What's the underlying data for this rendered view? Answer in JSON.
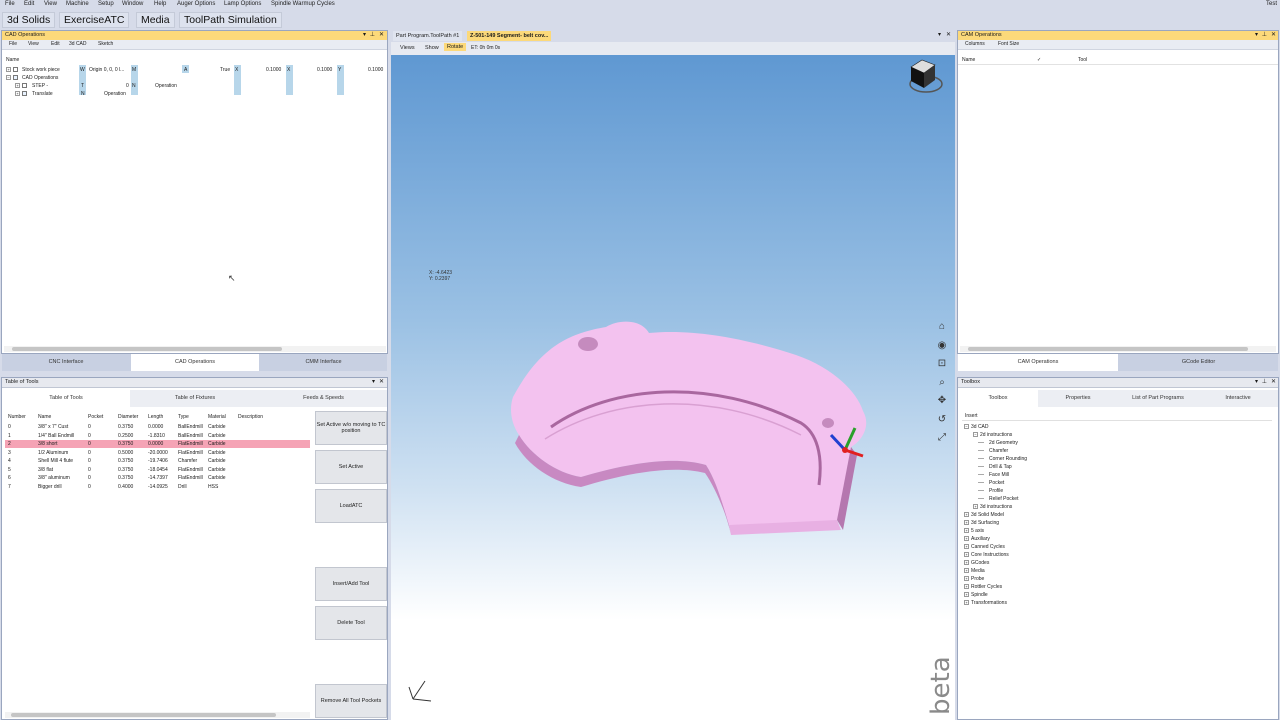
{
  "menu": [
    "File",
    "Edit",
    "View",
    "Machine",
    "Setup",
    "Window",
    "Help",
    "Auger Options",
    "Lamp Options",
    "Spindle Warmup Cycles"
  ],
  "menu_right": "Test",
  "toolbar": [
    "3d Solids",
    "ExerciseATC",
    "Media",
    "ToolPath Simulation"
  ],
  "cad_panel": {
    "title": "CAD Operations",
    "submenu": [
      "File",
      "View",
      "Edit",
      "3d CAD",
      "Sketch"
    ],
    "header_name": "Name",
    "rows": [
      {
        "label": "Stock work piece",
        "w": "W",
        "origin": "Origin 0, 0, 0 l...",
        "m": "M",
        "a": "A",
        "true_val": "True",
        "v1": "0.1000",
        "x": "X",
        "v2": "0.1000",
        "y": "Y",
        "v3": "0.1000"
      },
      {
        "label": "CAD Operations"
      },
      {
        "label": "STEP -",
        "t": "T",
        "zero": "0",
        "n": "N",
        "op": "Operation"
      },
      {
        "label": "Translate",
        "n": "N",
        "op": "Operation"
      }
    ],
    "tabs": [
      "CNC Interface",
      "CAD Operations",
      "CMM Interface"
    ]
  },
  "tools_panel": {
    "title": "Table of Tools",
    "tabs": [
      "Table of Tools",
      "Table of Fixtures",
      "Feeds & Speeds"
    ],
    "columns": [
      "Number",
      "Name",
      "Pocket",
      "Diameter",
      "Length",
      "Type",
      "Material",
      "Description"
    ],
    "rows": [
      [
        "0",
        "3/8\" x 7\" Cust",
        "0",
        "0.3750",
        "0.0000",
        "BallEndmill",
        "Carbide",
        ""
      ],
      [
        "1",
        "1/4\" Ball Endmill",
        "0",
        "0.2500",
        "-1.8310",
        "BallEndmill",
        "Carbide",
        ""
      ],
      [
        "2",
        "3/8 short",
        "0",
        "0.3750",
        "0.0000",
        "FlatEndmill",
        "Carbide",
        ""
      ],
      [
        "3",
        "1/2 Aluminum",
        "0",
        "0.5000",
        "-20.0000",
        "FlatEndmill",
        "Carbide",
        ""
      ],
      [
        "4",
        "Shell Mill 4 flute",
        "0",
        "0.3750",
        "-19.7406",
        "Chamfer",
        "Carbide",
        ""
      ],
      [
        "5",
        "3/8 flat",
        "0",
        "0.3750",
        "-18.0454",
        "FlatEndmill",
        "Carbide",
        ""
      ],
      [
        "6",
        "3/8\" aluminum",
        "0",
        "0.3750",
        "-14.7397",
        "FlatEndmill",
        "Carbide",
        ""
      ],
      [
        "7",
        "Bigger drill",
        "0",
        "0.4000",
        "-14.0925",
        "Drill",
        "HSS",
        ""
      ]
    ],
    "selected_row": 2,
    "buttons": [
      "Set Active w/o moving to TC position",
      "Set Active",
      "LoadATC",
      "Insert/Add Tool",
      "Delete Tool",
      "Remove All Tool Pockets"
    ]
  },
  "viewport": {
    "doc_tabs": [
      "Part Program.ToolPath #1",
      "Z-501-149 Segment- belt cov..."
    ],
    "view_menu": [
      "Views",
      "Show",
      "Rotate",
      "ET: 0h 0m 0s"
    ],
    "coord_x": "X: -4.6423",
    "coord_y": "Y: 0.2397",
    "watermark": "beta",
    "part_color": "#f5c6f2"
  },
  "cam_panel": {
    "title": "CAM Operations",
    "submenu": [
      "Columns",
      "Font Size"
    ],
    "columns": [
      "Name",
      "✓",
      "Tool"
    ],
    "tabs": [
      "CAM Operations",
      "GCode Editor"
    ]
  },
  "toolbox": {
    "title": "Toolbox",
    "tabs": [
      "Toolbox",
      "Properties",
      "List of Part Programs",
      "Interactive"
    ],
    "insert": "Insert",
    "tree": [
      {
        "label": "3d CAD",
        "level": 0,
        "exp": "-"
      },
      {
        "label": "2d instructions",
        "level": 1,
        "exp": "-"
      },
      {
        "label": "2d Geometry",
        "level": 2
      },
      {
        "label": "Chamfer",
        "level": 2
      },
      {
        "label": "Corner Rounding",
        "level": 2
      },
      {
        "label": "Drill & Tap",
        "level": 2
      },
      {
        "label": "Face Mill",
        "level": 2
      },
      {
        "label": "Pocket",
        "level": 2
      },
      {
        "label": "Profile",
        "level": 2
      },
      {
        "label": "Relief Pocket",
        "level": 2
      },
      {
        "label": "3d instructions",
        "level": 1,
        "exp": "+"
      },
      {
        "label": "3d Solid Model",
        "level": 0,
        "exp": "+"
      },
      {
        "label": "3d Surfacing",
        "level": 0,
        "exp": "+"
      },
      {
        "label": "5 axis",
        "level": 0,
        "exp": "+"
      },
      {
        "label": "Auxiliary",
        "level": 0,
        "exp": "+"
      },
      {
        "label": "Canned Cycles",
        "level": 0,
        "exp": "+"
      },
      {
        "label": "Core Instructions",
        "level": 0,
        "exp": "+"
      },
      {
        "label": "GCodes",
        "level": 0,
        "exp": "+"
      },
      {
        "label": "Media",
        "level": 0,
        "exp": "+"
      },
      {
        "label": "Probe",
        "level": 0,
        "exp": "+"
      },
      {
        "label": "Rottler Cycles",
        "level": 0,
        "exp": "+"
      },
      {
        "label": "Spindle",
        "level": 0,
        "exp": "+"
      },
      {
        "label": "Transformations",
        "level": 0,
        "exp": "+"
      }
    ]
  },
  "colors": {
    "title_active": "#fcd97a",
    "selected_row": "#f5a3b5",
    "viewport_top": "#5f98d2"
  }
}
